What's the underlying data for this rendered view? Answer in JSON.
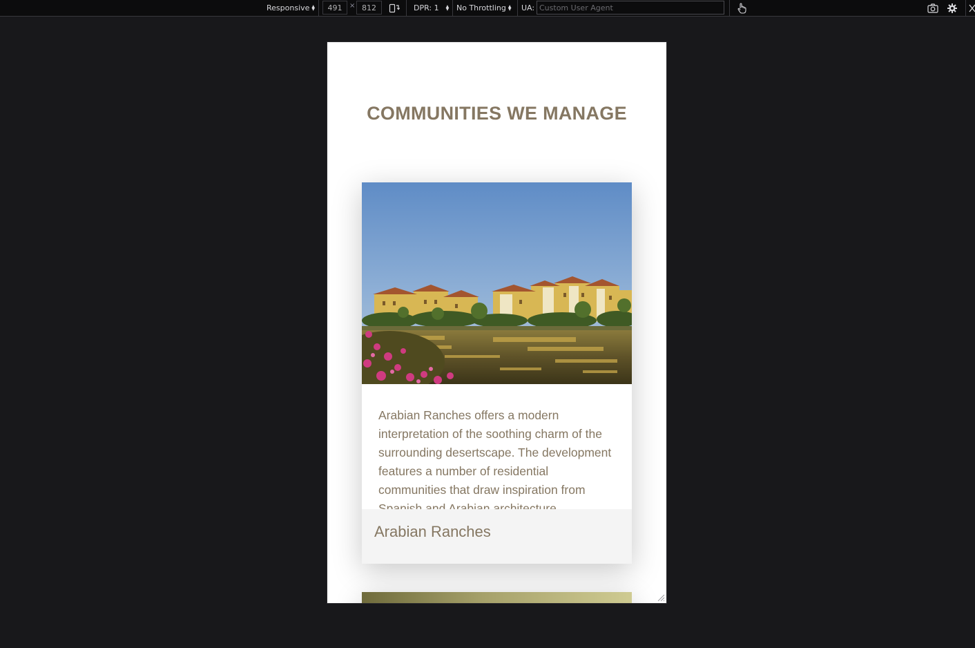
{
  "toolbar": {
    "device_label": "Responsive",
    "width_value": "491",
    "times_symbol": "×",
    "height_value": "812",
    "dpr_label": "DPR: 1",
    "throttling_label": "No Throttling",
    "ua_label": "UA:",
    "ua_placeholder": "Custom User Agent"
  },
  "page": {
    "section_title": "COMMUNITIES WE MANAGE",
    "cards": [
      {
        "description": "Arabian Ranches offers a modern interpretation of the soothing charm of the surrounding desertscape. The development features a number of residential communities that draw inspiration from Spanish and Arabian architecture.",
        "name": "Arabian Ranches"
      }
    ]
  },
  "colors": {
    "heading": "#857762",
    "body_text": "#857762",
    "toolbar_bg": "#0c0c0d",
    "backdrop": "#18181b"
  }
}
